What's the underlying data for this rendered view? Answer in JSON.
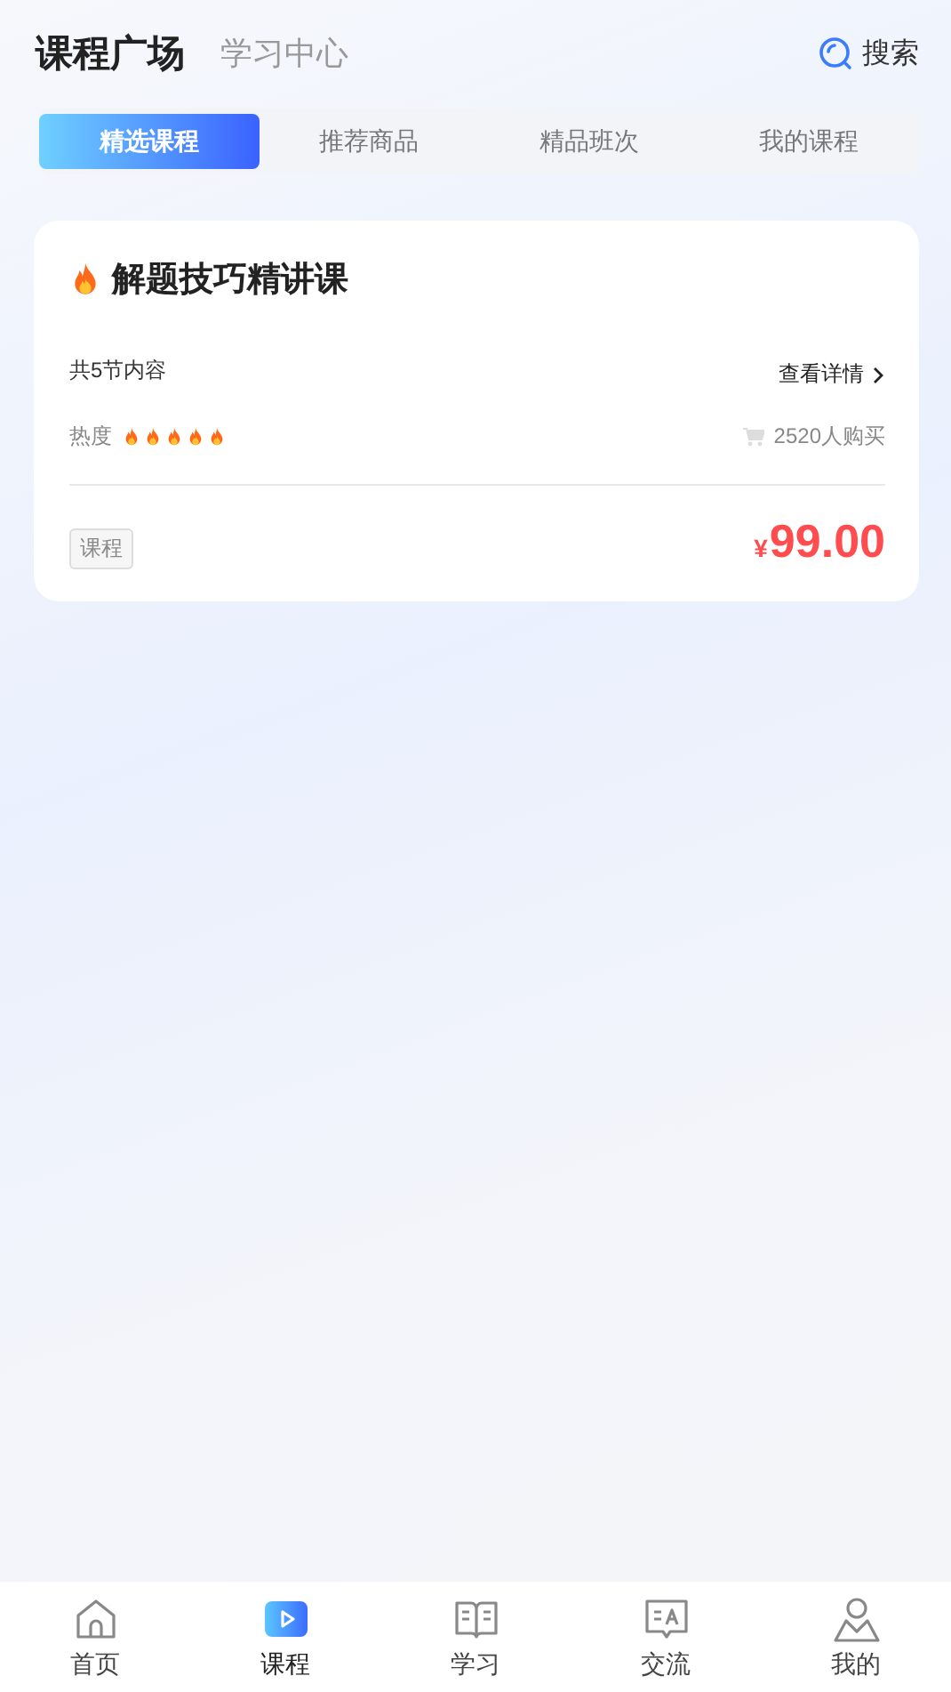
{
  "header": {
    "tabs": [
      {
        "label": "课程广场",
        "selected": true
      },
      {
        "label": "学习中心",
        "selected": false
      }
    ],
    "search": {
      "label": "搜索"
    }
  },
  "segments": [
    {
      "label": "精选课程",
      "selected": true
    },
    {
      "label": "推荐商品",
      "selected": false
    },
    {
      "label": "精品班次",
      "selected": false
    },
    {
      "label": "我的课程",
      "selected": false
    }
  ],
  "course": {
    "title": "解题技巧精讲课",
    "lessons": "共5节内容",
    "details_link": "查看详情",
    "heat_label": "热度",
    "stars": 5,
    "buyers": "2520人购买",
    "tag": "课程",
    "currency": "¥",
    "price": "99.00"
  },
  "bottom_nav": [
    {
      "label": "首页",
      "kind": "home",
      "selected": false
    },
    {
      "label": "课程",
      "kind": "course",
      "selected": true
    },
    {
      "label": "学习",
      "kind": "study",
      "selected": false
    },
    {
      "label": "交流",
      "kind": "chat",
      "selected": false
    },
    {
      "label": "我的",
      "kind": "profile",
      "selected": false
    }
  ]
}
